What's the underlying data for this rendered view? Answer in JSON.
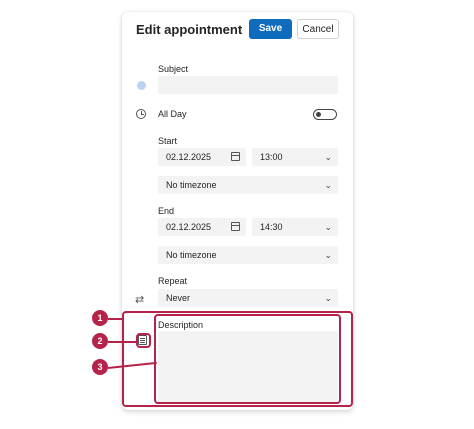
{
  "dialog": {
    "title": "Edit appointment",
    "save_label": "Save",
    "cancel_label": "Cancel"
  },
  "subject": {
    "label": "Subject",
    "value": ""
  },
  "all_day": {
    "label": "All Day",
    "enabled": false
  },
  "start": {
    "label": "Start",
    "date": "02.12.2025",
    "time": "13:00",
    "timezone": "No timezone"
  },
  "end": {
    "label": "End",
    "date": "02.12.2025",
    "time": "14:30",
    "timezone": "No timezone"
  },
  "repeat": {
    "label": "Repeat",
    "value": "Never"
  },
  "description": {
    "label": "Description",
    "value": ""
  },
  "annotations": [
    "1",
    "2",
    "3"
  ],
  "colors": {
    "accent": "#0f6cbd",
    "annotation": "#b5224a",
    "subject_dot": "#b9d3f0"
  }
}
